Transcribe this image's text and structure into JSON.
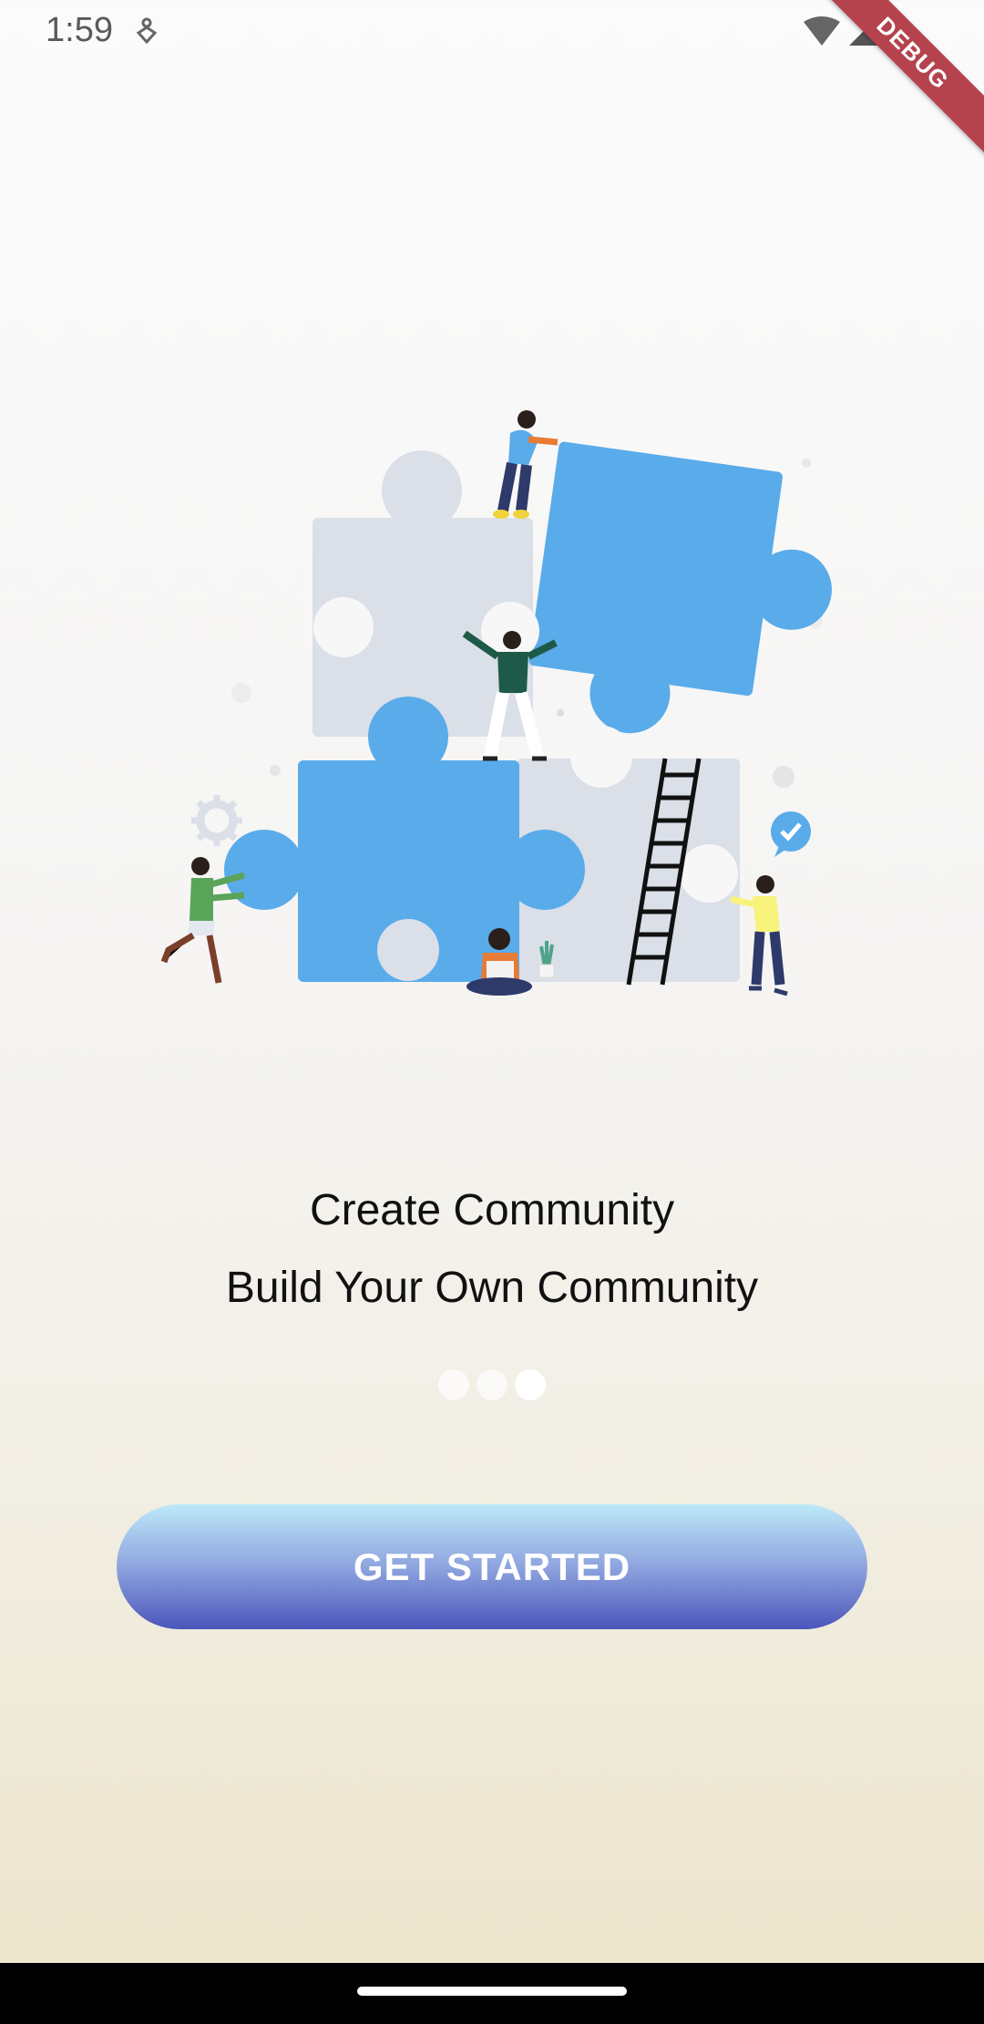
{
  "status_bar": {
    "time": "1:59",
    "icons": [
      "notification-icon",
      "wifi-icon",
      "signal-icon"
    ]
  },
  "debug_banner": "DEBUG",
  "onboarding": {
    "title": "Create Community",
    "subtitle": "Build Your Own Community",
    "page_indicator": {
      "pages": 3,
      "current": 3
    },
    "cta_label": "GET STARTED"
  },
  "colors": {
    "puzzle_blue": "#5aabea",
    "puzzle_gray": "#dadfe8",
    "button_top": "#bde9f8",
    "button_bottom": "#4b56bb"
  }
}
